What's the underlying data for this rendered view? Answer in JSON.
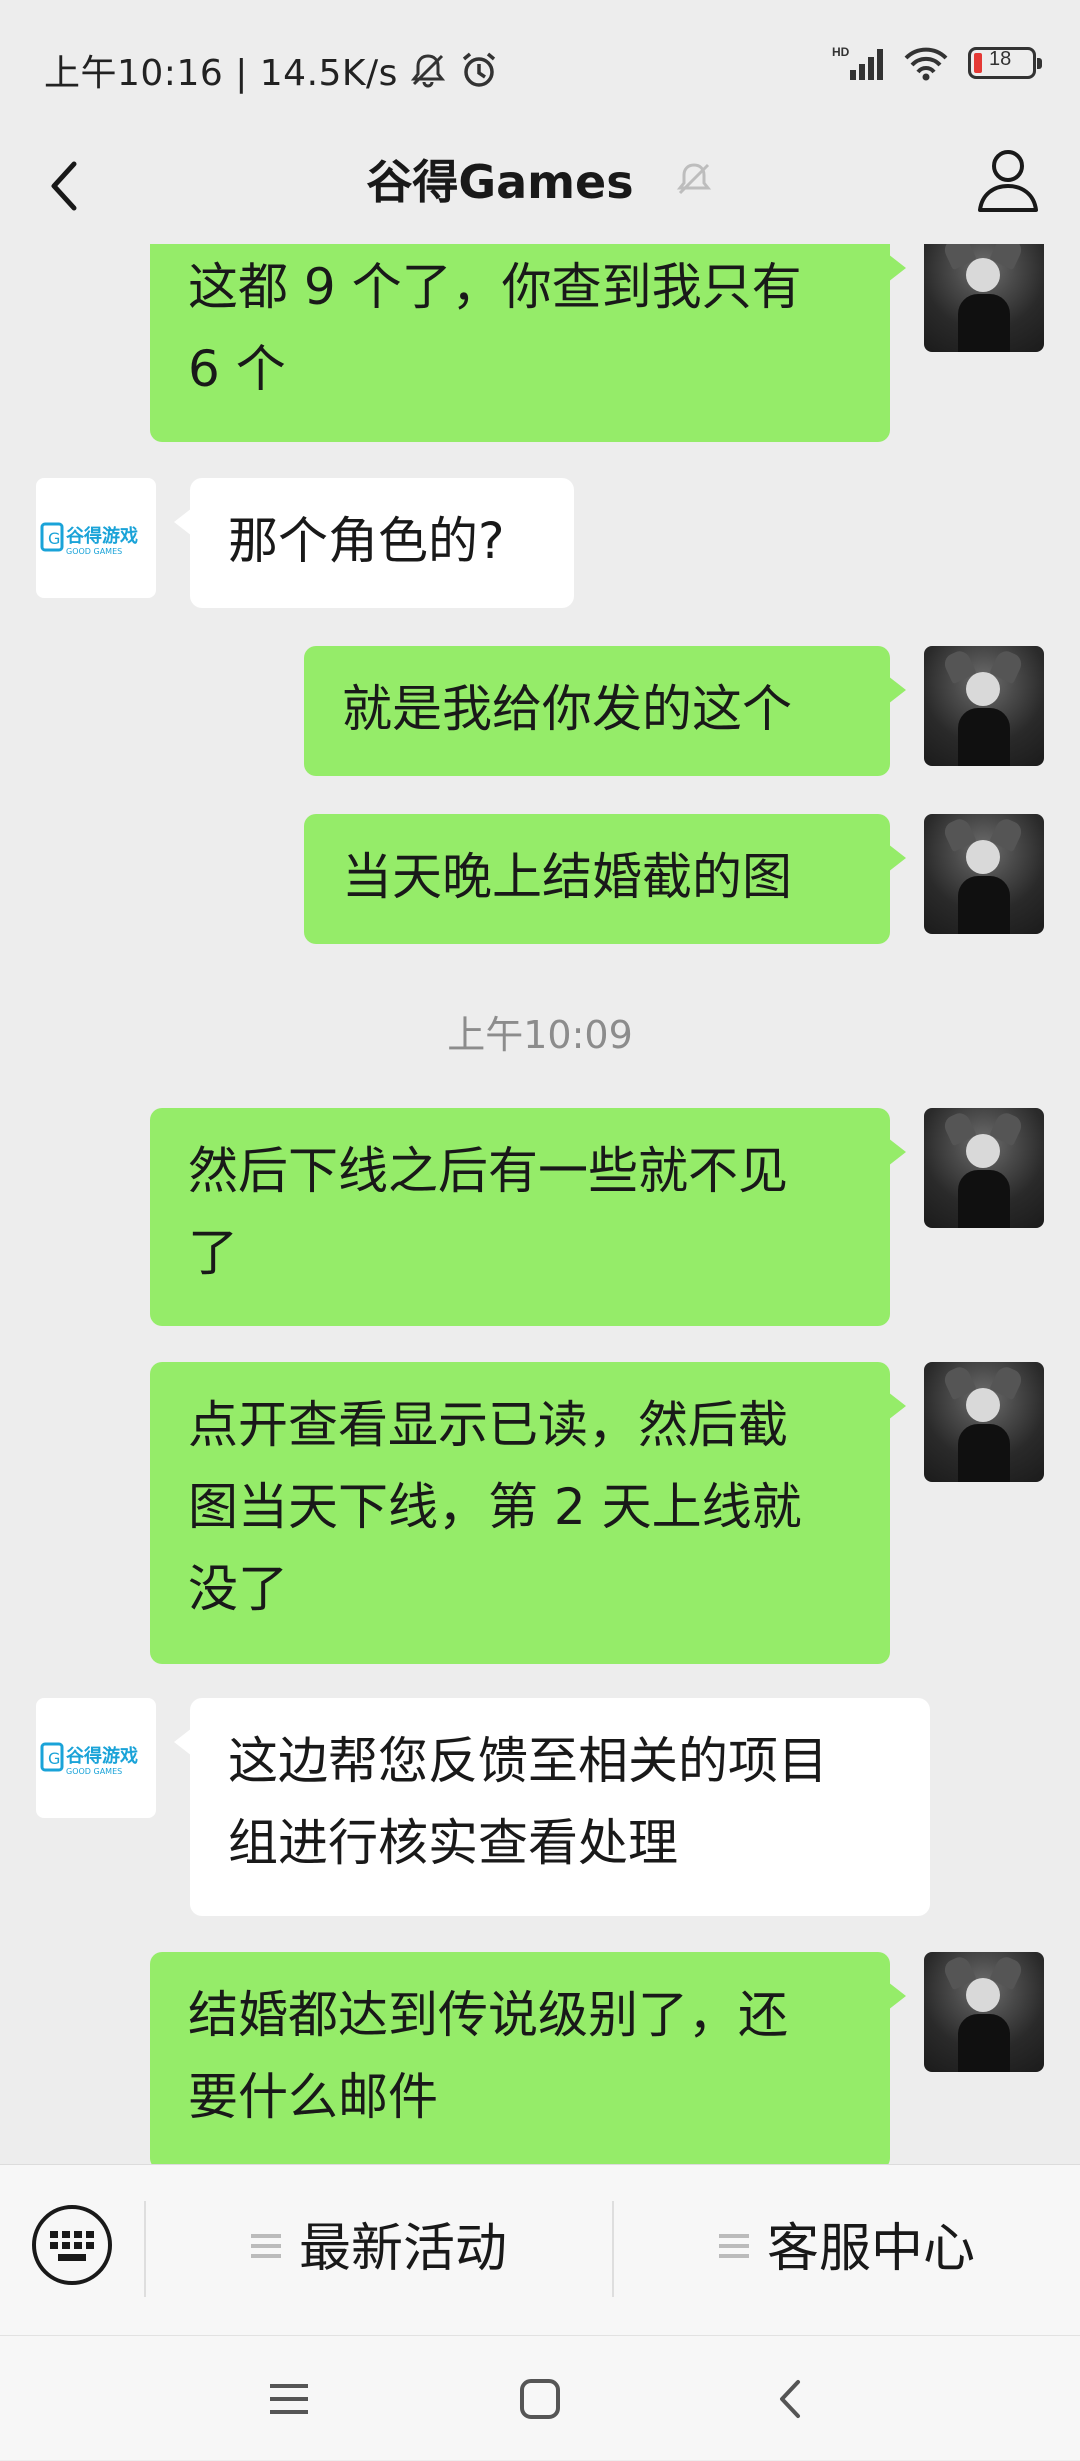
{
  "status_bar": {
    "time_speed": "上午10:16 | 14.5K/s",
    "battery": "18",
    "network": "HD"
  },
  "header": {
    "title": "谷得Games"
  },
  "messages": [
    {
      "from": "me",
      "text_lines": [
        "这都 9 个了，你查到我只有",
        "6 个"
      ]
    },
    {
      "from": "other",
      "text_lines": [
        "那个角色的?"
      ]
    },
    {
      "from": "me",
      "text_lines": [
        "就是我给你发的这个"
      ]
    },
    {
      "from": "me",
      "text_lines": [
        "当天晚上结婚截的图"
      ]
    },
    {
      "from": "time",
      "text": "上午10:09"
    },
    {
      "from": "me",
      "text_lines": [
        "然后下线之后有一些就不见",
        "了"
      ]
    },
    {
      "from": "me",
      "text_lines": [
        "点开查看显示已读，然后截",
        "图当天下线，第 2 天上线就",
        "没了"
      ]
    },
    {
      "from": "other",
      "text_lines": [
        "这边帮您反馈至相关的项目",
        "组进行核实查看处理"
      ]
    },
    {
      "from": "me",
      "text_lines": [
        "结婚都达到传说级别了，还",
        "要什么邮件"
      ]
    }
  ],
  "other_avatar": {
    "logo_text": "谷得游戏",
    "logo_sub": "GOOD GAMES"
  },
  "bottom_menu": {
    "item1": "最新活动",
    "item2": "客服中心"
  },
  "colors": {
    "my_bubble": "#95ec69",
    "other_bubble": "#ffffff",
    "background": "#ededed",
    "logo_blue": "#1aa3d8"
  }
}
